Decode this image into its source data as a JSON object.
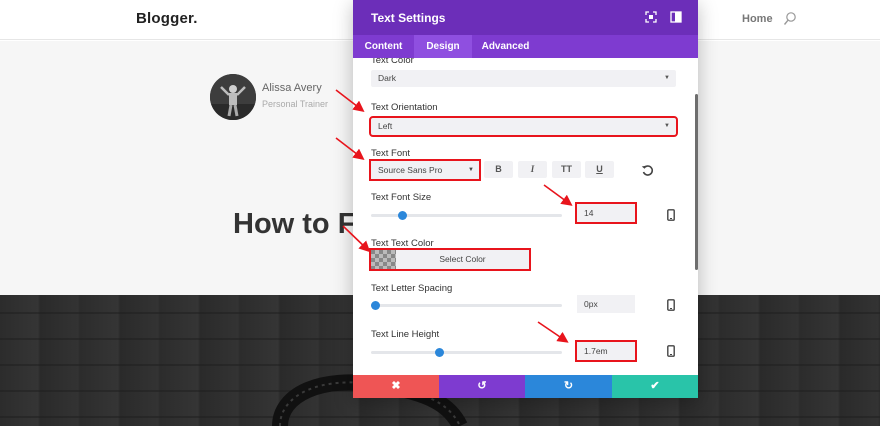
{
  "site": {
    "logo": "Blogger.",
    "nav_home": "Home",
    "author_name": "Alissa Avery",
    "author_role": "Personal Trainer",
    "post_title_visible": "How to Fi"
  },
  "modal": {
    "title": "Text Settings",
    "tabs": [
      {
        "label": "Content",
        "active": false
      },
      {
        "label": "Design",
        "active": true
      },
      {
        "label": "Advanced",
        "active": false
      }
    ],
    "fields": {
      "text_color": {
        "label": "Text Color",
        "value": "Dark"
      },
      "text_orientation": {
        "label": "Text Orientation",
        "value": "Left"
      },
      "text_font": {
        "label": "Text Font",
        "value": "Source Sans Pro",
        "style_buttons": [
          "B",
          "I",
          "TT",
          "U"
        ]
      },
      "text_font_size": {
        "label": "Text Font Size",
        "value": "14",
        "slider_fraction": 0.15
      },
      "text_text_color": {
        "label": "Text Text Color",
        "button": "Select Color"
      },
      "text_letter_spacing": {
        "label": "Text Letter Spacing",
        "value": "0px",
        "slider_fraction": 0.0
      },
      "text_line_height": {
        "label": "Text Line Height",
        "value": "1.7em",
        "slider_fraction": 0.35
      }
    },
    "footer": {
      "discard": "✖",
      "undo": "↺",
      "redo": "↻",
      "save": "✔"
    }
  },
  "colors": {
    "header_purple": "#6c2eb9",
    "tab_purple": "#7e3bd0",
    "highlight_red": "#e8141c",
    "slider_blue": "#2b87da",
    "discard_red": "#ef5555",
    "save_green": "#29c4a9"
  },
  "icons": {
    "search": "search-icon",
    "fullscreen": "fullscreen-icon",
    "sidebar": "sidebar-toggle-icon",
    "reset": "reset-icon",
    "responsive": "phone-icon"
  }
}
